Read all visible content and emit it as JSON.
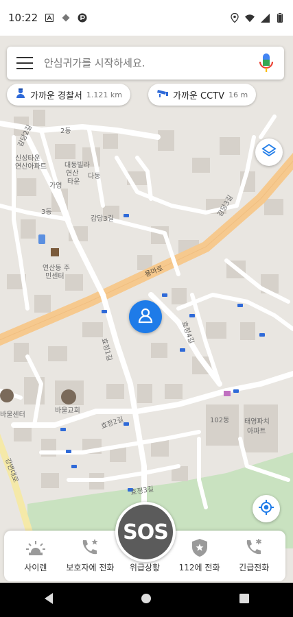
{
  "status_bar": {
    "time": "10:22",
    "left_icons": [
      "a-icon",
      "diamond-icon",
      "p-icon"
    ],
    "right_icons": [
      "location-icon",
      "wifi-icon",
      "signal-icon",
      "battery-icon"
    ]
  },
  "search": {
    "placeholder": "안심귀가를 시작하세요.",
    "menu_icon": "hamburger-icon",
    "mic_icon": "mic-icon"
  },
  "chips": {
    "police": {
      "label": "가까운 경찰서",
      "distance": "1.121 km",
      "icon": "police-icon"
    },
    "cctv": {
      "label": "가까운 CCTV",
      "distance": "16 m",
      "icon": "cctv-icon"
    }
  },
  "map": {
    "labels": {
      "l2dong": "2동",
      "l3dong": "3동",
      "gamdang2": "감당2길",
      "gamdang3": "감당3길",
      "gamdang3b": "감당3길",
      "sinsaeng": "신성타운",
      "sinsaeng2": "연산아파트",
      "daedong": "대동빌라",
      "daedong2": "연산",
      "daedong3": "타운",
      "gayoung": "가영",
      "dadong": "다동",
      "community": "연산동 주",
      "community2": "민센터",
      "yongaro": "용마로",
      "hyojeong1": "효정1길",
      "hyojeong2": "효정2길",
      "hyojeong3": "효정3길",
      "hyojeong4": "효정4길",
      "church": "바울교회",
      "center": "바울센터",
      "apt102": "102동",
      "apt": "태영파치",
      "apt2": "아파트",
      "gangbyeon": "강변대로"
    },
    "colors": {
      "base": "#e9e6e1",
      "road": "#ffffff",
      "main_road": "#f6c98e",
      "park": "#c9e2c0",
      "building": "#d6d1ca"
    }
  },
  "user_pin_icon": "person-icon",
  "layers_icon": "layers-icon",
  "locate_icon": "my-location-icon",
  "bottom_bar": {
    "siren": {
      "label": "사이렌",
      "icon": "siren-icon"
    },
    "guardian": {
      "label": "보호자에 전화",
      "icon": "phone-star-icon"
    },
    "emergency": {
      "label": "위급상황",
      "icon": "sos-icon"
    },
    "police112": {
      "label": "112에 전화",
      "icon": "police-badge-icon"
    },
    "urgent": {
      "label": "긴급전화",
      "icon": "phone-asterisk-icon"
    },
    "sos_text": "SOS"
  },
  "nav_bar": {
    "icons": [
      "back-icon",
      "home-icon",
      "recents-icon"
    ]
  }
}
